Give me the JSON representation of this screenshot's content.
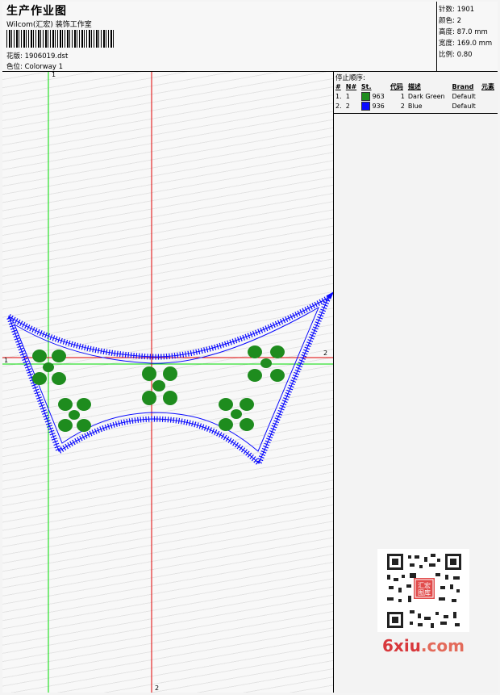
{
  "header": {
    "title": "生产作业图",
    "studio": "Wilcom(汇宏) 装饰工作室",
    "design_label": "花版:",
    "design_file": "1906019.dst",
    "colorway_label": "色位:",
    "colorway": "Colorway 1"
  },
  "info": {
    "stitches_label": "针数:",
    "stitches": "1901",
    "colors_label": "颜色:",
    "colors": "2",
    "height_label": "高度:",
    "height": "87.0 mm",
    "width_label": "宽度:",
    "width": "169.0 mm",
    "scale_label": "比例:",
    "scale": "0.80"
  },
  "stop_sequence": {
    "title": "停止顺序:",
    "headers": [
      "#",
      "N#",
      "St.",
      "代码",
      "描述",
      "Brand",
      "元素"
    ],
    "rows": [
      {
        "index": "1.",
        "needle": "1",
        "color": "#1e8c1e",
        "stitches": "963",
        "code": "1",
        "description": "Dark Green",
        "brand": "Default"
      },
      {
        "index": "2.",
        "needle": "2",
        "color": "#0a0aff",
        "stitches": "936",
        "code": "2",
        "description": "Blue",
        "brand": "Default"
      }
    ]
  },
  "guides": {
    "green_v": "1",
    "green_h": "1",
    "red_h": "2",
    "red_v": "2"
  },
  "watermark": {
    "name": "6xiu",
    "tld": ".com",
    "stamp": "汇宏图库"
  },
  "colors": {
    "thread_green": "#1e8c1e",
    "thread_blue": "#0a0aff",
    "guide_green": "#00dd00",
    "guide_red": "#e00000"
  }
}
